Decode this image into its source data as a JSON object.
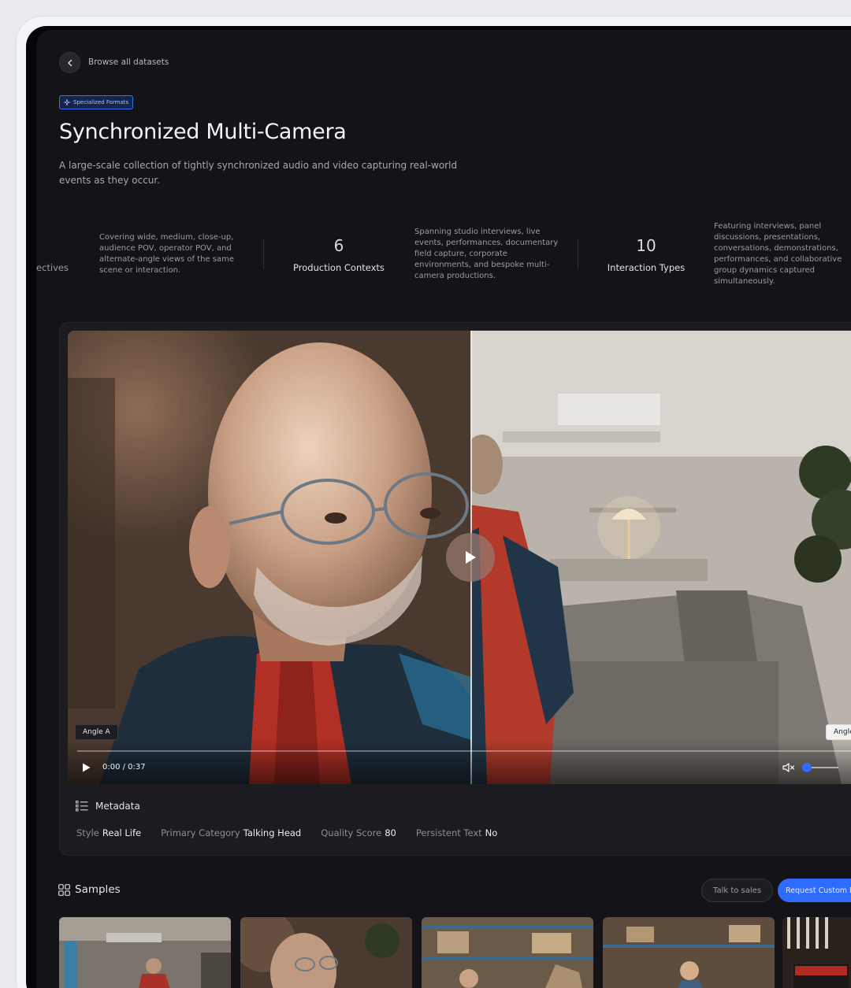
{
  "nav": {
    "back_label": "Browse all datasets"
  },
  "badge": {
    "label": "Specialized Formats"
  },
  "header": {
    "title": "Synchronized Multi-Camera",
    "description": "A large-scale collection of tightly synchronized audio and video capturing real-world events as they occur."
  },
  "stats": {
    "partial_label": "ectives",
    "perspectives_text": "Covering wide, medium, close-up, audience POV, operator POV, and alternate-angle views of the same scene or interaction.",
    "contexts_value": "6",
    "contexts_label": "Production Contexts",
    "contexts_text": "Spanning studio interviews, live events, performances, documentary field capture, corporate environments, and bespoke multi-camera productions.",
    "interaction_value": "10",
    "interaction_label": "Interaction Types",
    "interaction_text": "Featuring interviews, panel discussions, presentations, conversations, demonstrations, performances, and collaborative group dynamics captured simultaneously."
  },
  "player": {
    "angle_a": "Angle A",
    "angle_b": "Angle",
    "time": "0:00 / 0:37",
    "progress": 0,
    "volume": 0
  },
  "metadata": {
    "heading": "Metadata",
    "items": [
      {
        "key": "Style",
        "value": "Real Life"
      },
      {
        "key": "Primary Category",
        "value": "Talking Head"
      },
      {
        "key": "Quality Score",
        "value": "80"
      },
      {
        "key": "Persistent Text",
        "value": "No"
      }
    ]
  },
  "samples": {
    "heading": "Samples",
    "talk_button": "Talk to sales",
    "request_button": "Request Custom D"
  },
  "colors": {
    "accent": "#2f6bff",
    "background": "#141418"
  }
}
